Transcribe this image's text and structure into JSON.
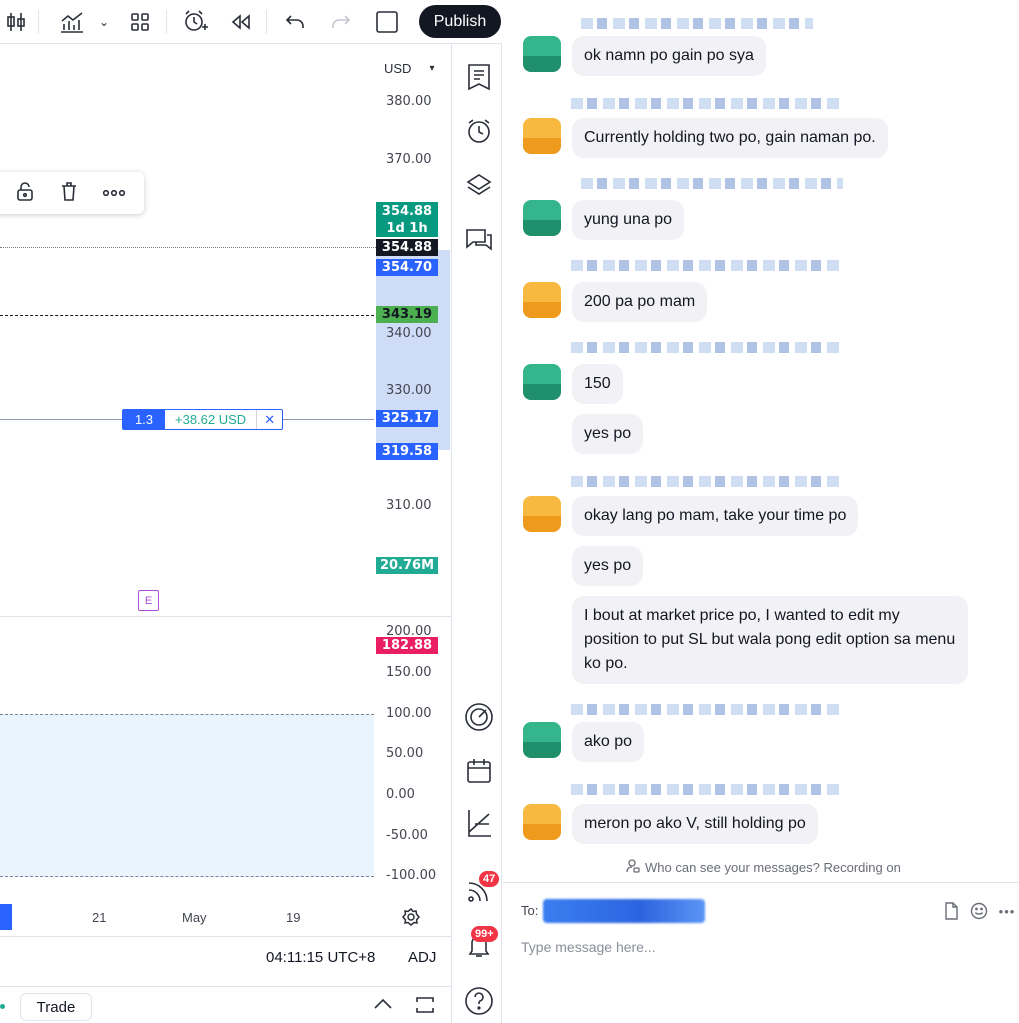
{
  "toolbar": {
    "publish_label": "Publish"
  },
  "chart": {
    "currency": "USD",
    "price_ticks": [
      "380.00",
      "370.00",
      "340.00",
      "330.00",
      "310.00"
    ],
    "labels": {
      "last_price": "354.88",
      "countdown": "1d 1h",
      "dotted_price": "354.88",
      "high_band": "354.70",
      "dashed_price": "343.19",
      "position_price": "325.17",
      "low_band": "319.58",
      "volume": "20.76M",
      "indicator_value": "182.88"
    },
    "position": {
      "quantity": "1.3",
      "pnl": "+38.62 USD",
      "close_glyph": "✕"
    },
    "earnings_marker": "E",
    "indicator_ticks": [
      "200.00",
      "150.00",
      "100.00",
      "50.00",
      "0.00",
      "-50.00",
      "-100.00"
    ],
    "time_ticks": [
      "21",
      "May",
      "19"
    ],
    "clock": "04:11:15 UTC+8",
    "adj_label": "ADJ",
    "trade_tab": "Trade"
  },
  "widgets": {
    "streams_badge": "47",
    "alerts_badge": "99+"
  },
  "chat": {
    "messages": [
      {
        "avatar": "green",
        "text": "ok namn po gain po sya"
      },
      {
        "avatar": "orange",
        "text": "Currently holding two po, gain naman po."
      },
      {
        "avatar": "green",
        "text": "yung una po"
      },
      {
        "avatar": "orange",
        "text": "200 pa po mam"
      },
      {
        "avatar": "green",
        "text": "150"
      },
      {
        "avatar": "",
        "text": "yes po"
      },
      {
        "avatar": "orange",
        "text": "okay lang po mam, take your time po"
      },
      {
        "avatar": "",
        "text": "yes po"
      },
      {
        "avatar": "",
        "text": "I bout at market price po, I wanted to edit my position to put SL but wala pong edit option sa menu ko po."
      },
      {
        "avatar": "green",
        "text": "ako po"
      },
      {
        "avatar": "orange",
        "text": "meron po ako V, still holding po"
      }
    ],
    "privacy_notice": "Who can see your messages? Recording on",
    "to_label": "To:",
    "message_placeholder": "Type message here..."
  },
  "colors": {
    "accent": "#2962ff",
    "green_label": "#089981",
    "red_label": "#f23645",
    "bubble": "#f2f2f6"
  }
}
